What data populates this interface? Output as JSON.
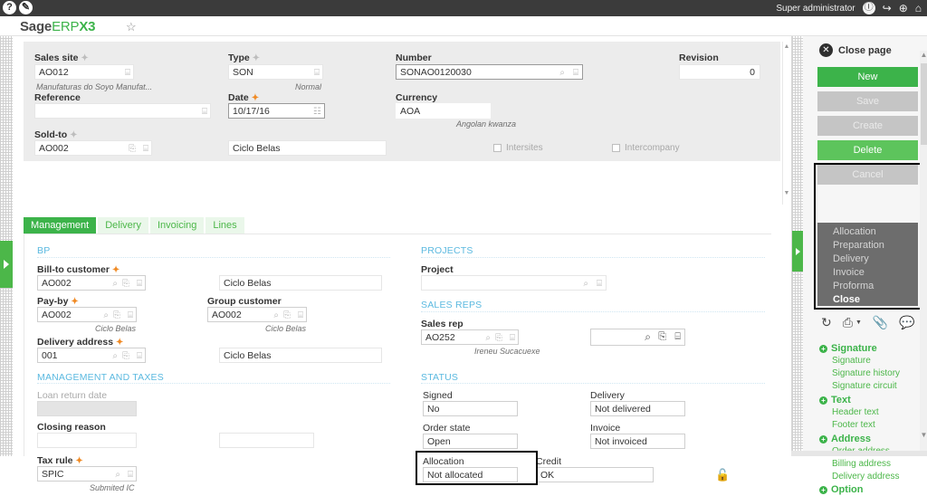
{
  "topbar": {
    "help_icon": "?",
    "edit_icon": "✎",
    "user": "Super administrator",
    "user_icon": "Ⓘ",
    "logout_icon": "↪",
    "globe_icon": "⊕",
    "home_icon": "⌂"
  },
  "brand": {
    "part1": "Sage",
    "part2": "ERP",
    "part3": "X3",
    "favorite_icon": "☆"
  },
  "header_fields": {
    "sales_site": {
      "label": "Sales site",
      "value": "AO012",
      "hint": "Manufaturas do Soyo Manufat...",
      "required": true
    },
    "reference": {
      "label": "Reference",
      "value": "",
      "required": false
    },
    "sold_to": {
      "label": "Sold-to",
      "value": "AO002",
      "name_value": "Ciclo Belas",
      "required": true
    },
    "type": {
      "label": "Type",
      "value": "SON",
      "hint": "Normal",
      "required": true
    },
    "date": {
      "label": "Date",
      "value": "10/17/16",
      "required": true
    },
    "number": {
      "label": "Number",
      "value": "SONAO0120030",
      "required": false
    },
    "currency": {
      "label": "Currency",
      "value": "AOA",
      "hint": "Angolan kwanza",
      "required": false
    },
    "revision": {
      "label": "Revision",
      "value": "0",
      "required": false
    },
    "intersites": {
      "label": "Intersites",
      "checked": false
    },
    "intercompany": {
      "label": "Intercompany",
      "checked": false
    }
  },
  "tabs": [
    {
      "label": "Management",
      "active": true
    },
    {
      "label": "Delivery",
      "active": false
    },
    {
      "label": "Invoicing",
      "active": false
    },
    {
      "label": "Lines",
      "active": false
    }
  ],
  "sections": {
    "bp": {
      "title": "BP",
      "bill_to_customer": {
        "label": "Bill-to customer",
        "value": "AO002",
        "name_value": "Ciclo Belas",
        "required": true
      },
      "pay_by": {
        "label": "Pay-by",
        "value": "AO002",
        "hint": "Ciclo Belas",
        "required": true
      },
      "group_customer": {
        "label": "Group customer",
        "value": "AO002",
        "hint": "Ciclo Belas",
        "required": false
      },
      "delivery_address": {
        "label": "Delivery address",
        "value": "001",
        "name_value": "Ciclo Belas",
        "required": true
      }
    },
    "management_and_taxes": {
      "title": "MANAGEMENT AND TAXES",
      "loan_return_date": {
        "label": "Loan return date",
        "value": "",
        "disabled": true
      },
      "closing_reason": {
        "label": "Closing reason",
        "value": ""
      },
      "tax_rule": {
        "label": "Tax rule",
        "value": "SPIC",
        "hint": "Submited IC",
        "required": true
      }
    },
    "projects": {
      "title": "PROJECTS",
      "project": {
        "label": "Project",
        "value": ""
      }
    },
    "sales_reps": {
      "title": "SALES REPS",
      "sales_rep": {
        "label": "Sales rep",
        "value": "AO252",
        "hint": "Ireneu Sucacuexe"
      },
      "sales_rep_2": {
        "value": ""
      }
    },
    "status": {
      "title": "STATUS",
      "signed": {
        "label": "Signed",
        "value": "No"
      },
      "order_state": {
        "label": "Order state",
        "value": "Open"
      },
      "allocation": {
        "label": "Allocation",
        "value": "Not allocated",
        "highlighted": true
      },
      "delivery": {
        "label": "Delivery",
        "value": "Not delivered"
      },
      "invoice": {
        "label": "Invoice",
        "value": "Not invoiced"
      },
      "credit": {
        "label": "Credit",
        "value": "OK"
      },
      "lock_icon": "🔓"
    }
  },
  "right_panel": {
    "close_page": {
      "label": "Close page",
      "icon": "✕"
    },
    "buttons": [
      {
        "label": "New",
        "style": "green"
      },
      {
        "label": "Save",
        "style": "grey"
      },
      {
        "label": "Create",
        "style": "grey"
      },
      {
        "label": "Delete",
        "style": "green2"
      },
      {
        "label": "Cancel",
        "style": "grey"
      }
    ],
    "dropdown_menu": {
      "highlighted": true,
      "items": [
        {
          "label": "Allocation",
          "active": false
        },
        {
          "label": "Preparation",
          "active": false
        },
        {
          "label": "Delivery",
          "active": false
        },
        {
          "label": "Invoice",
          "active": false
        },
        {
          "label": "Proforma",
          "active": false
        },
        {
          "label": "Close",
          "active": true
        }
      ]
    },
    "action_icons": [
      {
        "name": "refresh-icon",
        "glyph": "↻"
      },
      {
        "name": "print-icon",
        "glyph": "⎙"
      },
      {
        "name": "attachment-icon",
        "glyph": "📎"
      },
      {
        "name": "comment-icon",
        "glyph": "💬"
      }
    ],
    "link_groups": [
      {
        "title": "Signature",
        "items": [
          "Signature",
          "Signature history",
          "Signature circuit"
        ]
      },
      {
        "title": "Text",
        "items": [
          "Header text",
          "Footer text"
        ]
      },
      {
        "title": "Address",
        "items": [
          "Order address",
          "Billing address",
          "Delivery address"
        ]
      },
      {
        "title": "Option",
        "items": []
      }
    ],
    "expand_icon": "+",
    "scroll_up_icon": "▲",
    "scroll_down_icon": "▼"
  },
  "icons": {
    "lookup": "⌕",
    "detail": "⌸",
    "jump": "⎘",
    "calendar": "☷"
  }
}
